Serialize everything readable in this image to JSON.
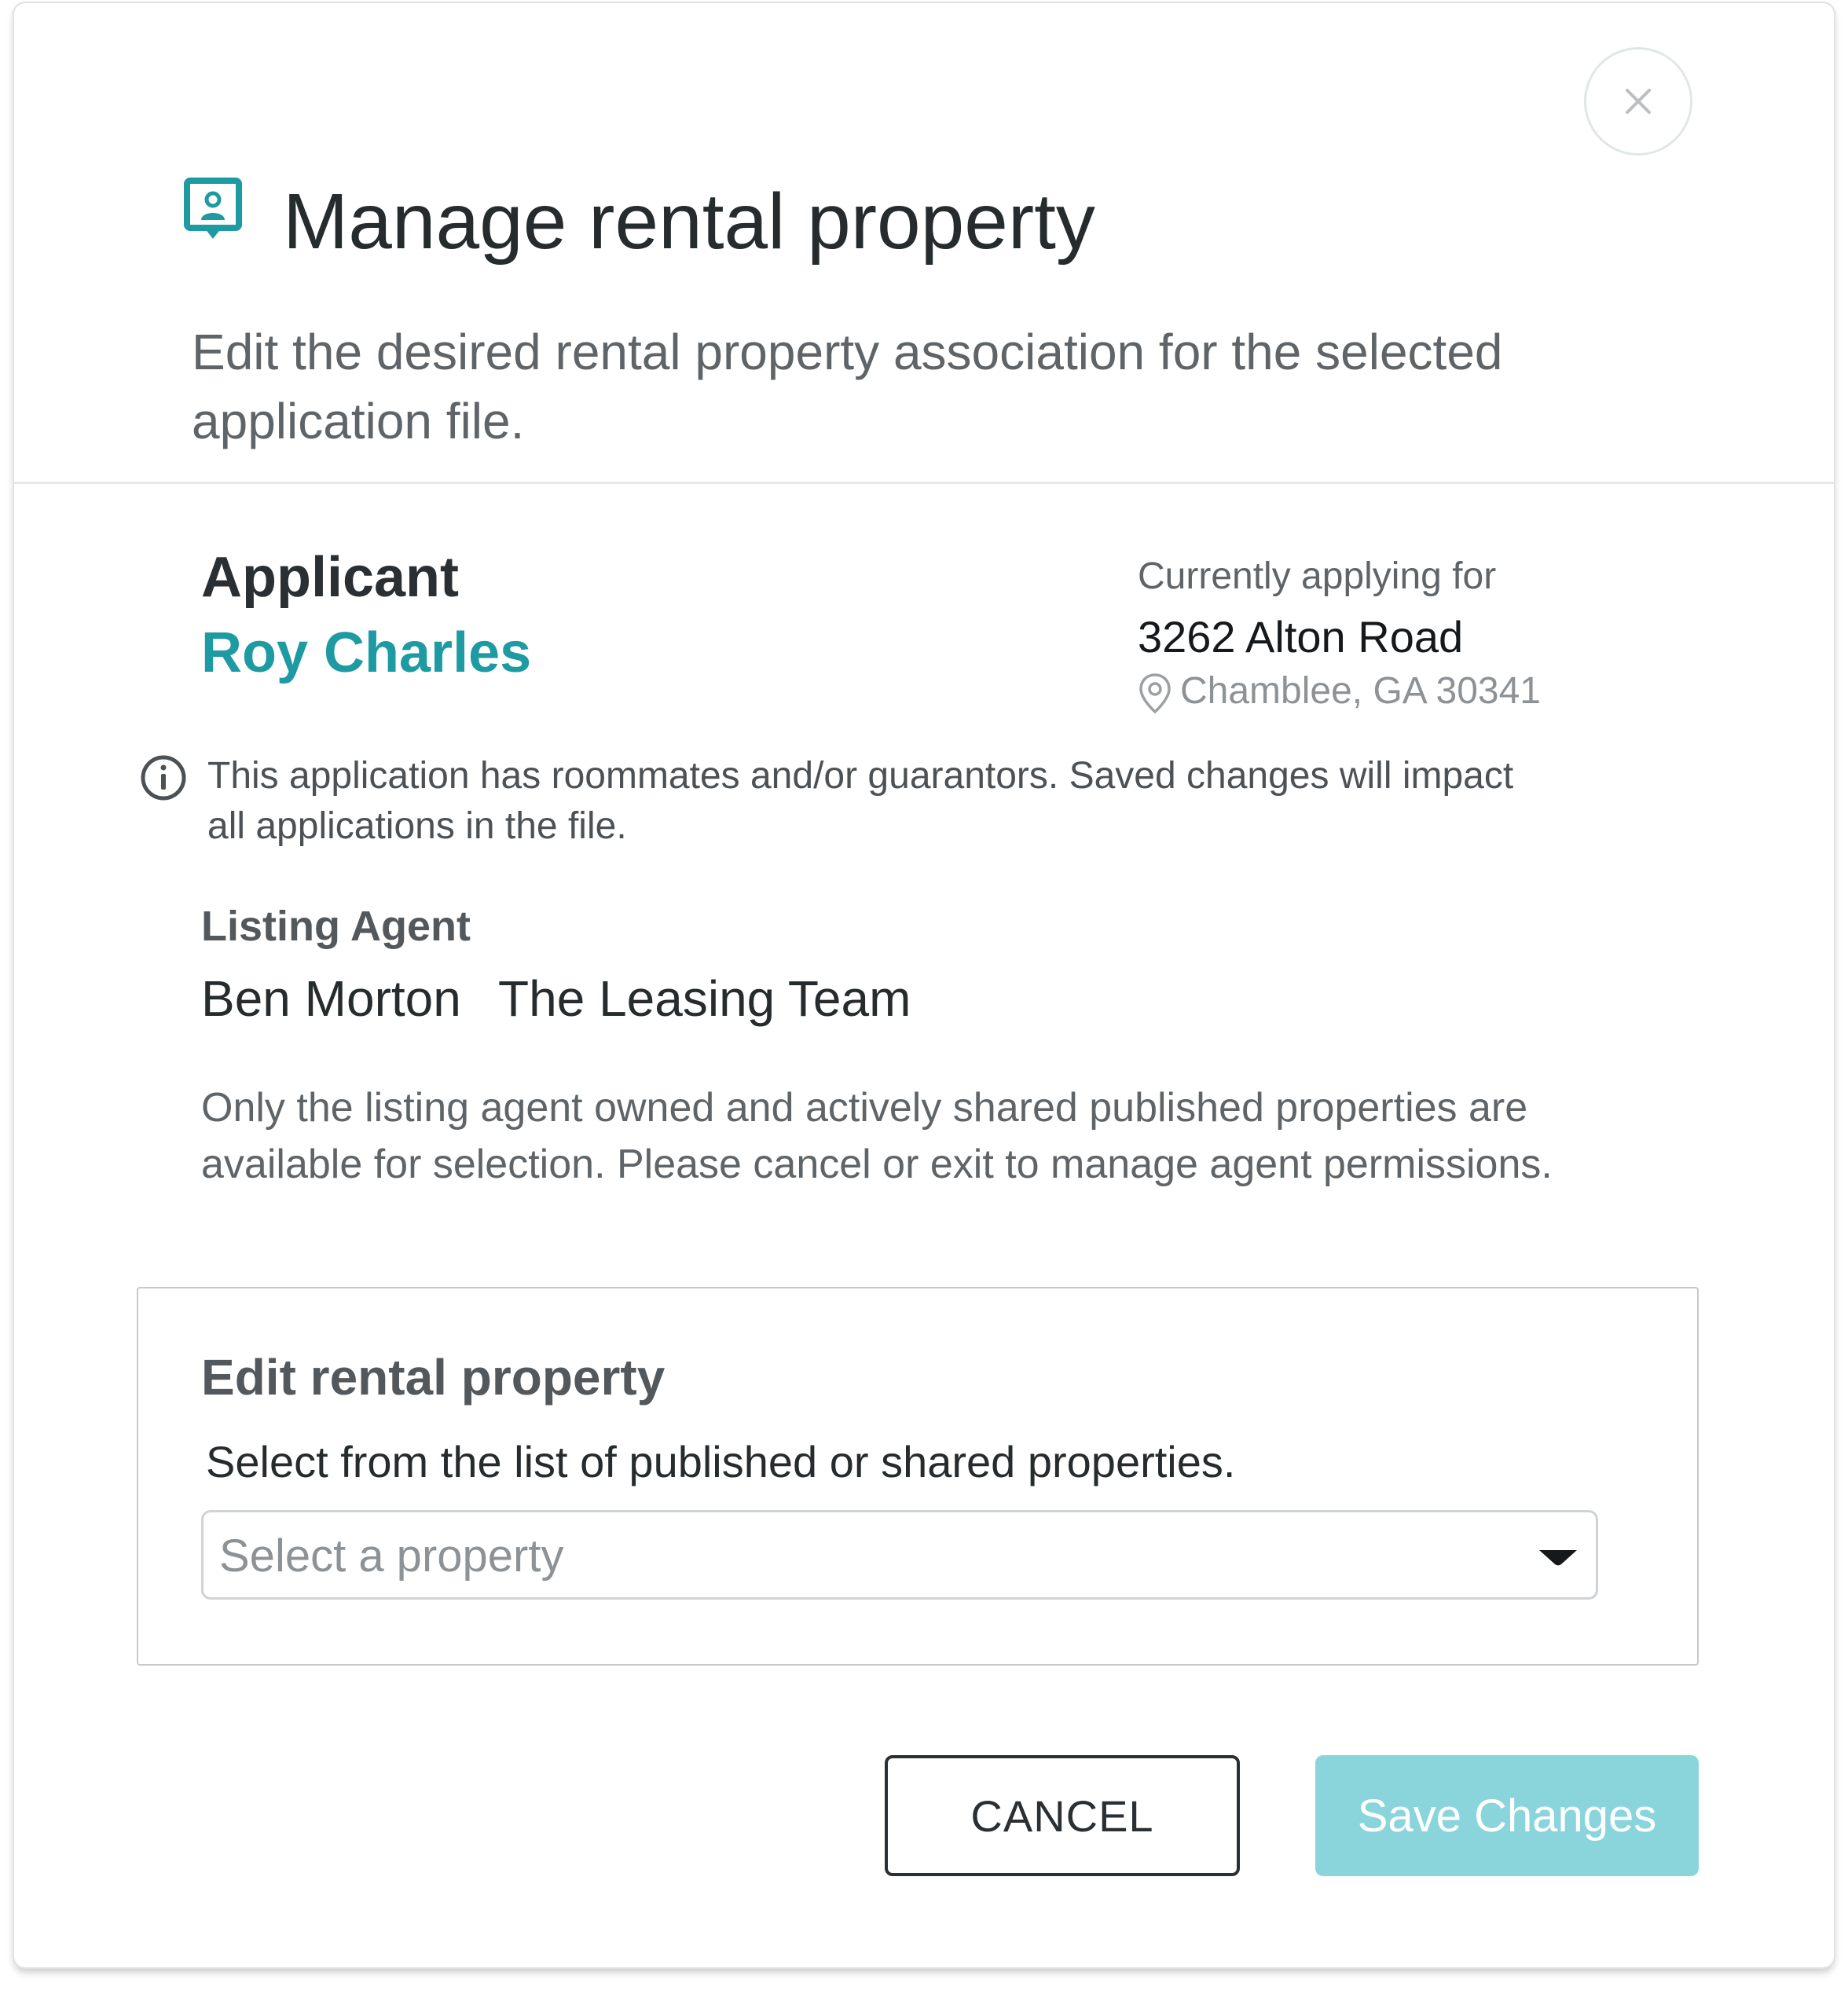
{
  "dialog": {
    "title": "Manage rental property",
    "title_icon": "property-agent-icon",
    "subtitle": "Edit the desired rental property association for the selected application file.",
    "close_icon": "close-icon"
  },
  "applicant": {
    "label": "Applicant",
    "name": "Roy Charles"
  },
  "applying_for": {
    "label": "Currently applying for",
    "street": "3262 Alton Road",
    "city": "Chamblee, GA 30341",
    "icon": "map-pin-icon"
  },
  "info": {
    "icon": "info-icon",
    "text": "This application has roommates and/or guarantors. Saved changes will impact all applications in the file."
  },
  "listing_agent": {
    "label": "Listing Agent",
    "name": "Ben Morton",
    "team": "The Leasing Team",
    "notice": "Only the listing agent owned and actively shared published properties are available for selection. Please cancel or exit to manage agent permissions."
  },
  "edit_property": {
    "title": "Edit rental property",
    "hint": "Select from the list of published or shared properties.",
    "select_placeholder": "Select a property",
    "caret_icon": "caret-down-icon"
  },
  "actions": {
    "cancel_label": "CANCEL",
    "save_label": "Save Changes"
  },
  "colors": {
    "accent": "#1d9aa2",
    "save_button": "#8ad5dc",
    "text_dark": "#262b2e",
    "text_muted": "#5f6468"
  }
}
